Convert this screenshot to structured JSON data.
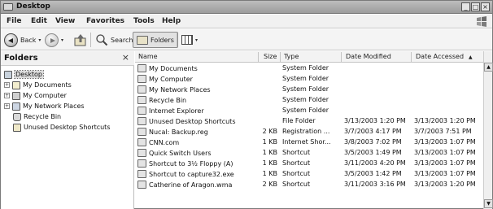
{
  "window": {
    "title": "Desktop"
  },
  "title_buttons": {
    "minimize": "_",
    "maximize": "□",
    "close": "×"
  },
  "menu": [
    "File",
    "Edit",
    "View",
    "Favorites",
    "Tools",
    "Help"
  ],
  "toolbar": {
    "back_label": "Back",
    "search_label": "Search",
    "folders_label": "Folders",
    "dropdown_arrow": "▾"
  },
  "folders_pane": {
    "title": "Folders",
    "close_glyph": "×",
    "tree": [
      {
        "label": "Desktop",
        "selected": true,
        "icon": "desktop-icon"
      },
      {
        "label": "My Documents",
        "expander": "+",
        "icon": "documents-icon"
      },
      {
        "label": "My Computer",
        "expander": "+",
        "icon": "computer-icon"
      },
      {
        "label": "My Network Places",
        "expander": "+",
        "icon": "network-icon"
      },
      {
        "label": "Recycle Bin",
        "icon": "recycle-bin-icon"
      },
      {
        "label": "Unused Desktop Shortcuts",
        "icon": "folder-icon"
      }
    ]
  },
  "list": {
    "columns": [
      "Name",
      "Size",
      "Type",
      "Date Modified",
      "Date Accessed"
    ],
    "sort_glyph": "▲",
    "rows": [
      {
        "name": "My Documents",
        "size": "",
        "type": "System Folder",
        "modified": "",
        "accessed": "",
        "icon": "documents-icon"
      },
      {
        "name": "My Computer",
        "size": "",
        "type": "System Folder",
        "modified": "",
        "accessed": "",
        "icon": "computer-icon"
      },
      {
        "name": "My Network Places",
        "size": "",
        "type": "System Folder",
        "modified": "",
        "accessed": "",
        "icon": "network-icon"
      },
      {
        "name": "Recycle Bin",
        "size": "",
        "type": "System Folder",
        "modified": "",
        "accessed": "",
        "icon": "recycle-bin-icon"
      },
      {
        "name": "Internet Explorer",
        "size": "",
        "type": "System Folder",
        "modified": "",
        "accessed": "",
        "icon": "internet-explorer-icon"
      },
      {
        "name": "Unused Desktop Shortcuts",
        "size": "",
        "type": "File Folder",
        "modified": "3/13/2003 1:20 PM",
        "accessed": "3/13/2003 1:20 PM",
        "icon": "folder-icon"
      },
      {
        "name": "Nucal: Backup.reg",
        "size": "2 KB",
        "type": "Registration ...",
        "modified": "3/7/2003 4:17 PM",
        "accessed": "3/7/2003 7:51 PM",
        "icon": "registry-file-icon"
      },
      {
        "name": "CNN.com",
        "size": "1 KB",
        "type": "Internet Shor...",
        "modified": "3/8/2003 7:02 PM",
        "accessed": "3/13/2003 1:07 PM",
        "icon": "internet-shortcut-icon"
      },
      {
        "name": "Quick Switch Users",
        "size": "1 KB",
        "type": "Shortcut",
        "modified": "3/5/2003 1:49 PM",
        "accessed": "3/13/2003 1:07 PM",
        "icon": "shortcut-icon"
      },
      {
        "name": "Shortcut to 3½ Floppy (A)",
        "size": "1 KB",
        "type": "Shortcut",
        "modified": "3/11/2003 4:20 PM",
        "accessed": "3/13/2003 1:07 PM",
        "icon": "floppy-shortcut-icon"
      },
      {
        "name": "Shortcut to capture32.exe",
        "size": "1 KB",
        "type": "Shortcut",
        "modified": "3/5/2003 1:42 PM",
        "accessed": "3/13/2003 1:07 PM",
        "icon": "app-shortcut-icon"
      },
      {
        "name": "Catherine of Aragon.wma",
        "size": "2 KB",
        "type": "Shortcut",
        "modified": "3/11/2003 3:16 PM",
        "accessed": "3/13/2003 1:20 PM",
        "icon": "media-file-icon"
      }
    ]
  },
  "scrollbar": {
    "up_glyph": "▲",
    "down_glyph": "▼"
  }
}
